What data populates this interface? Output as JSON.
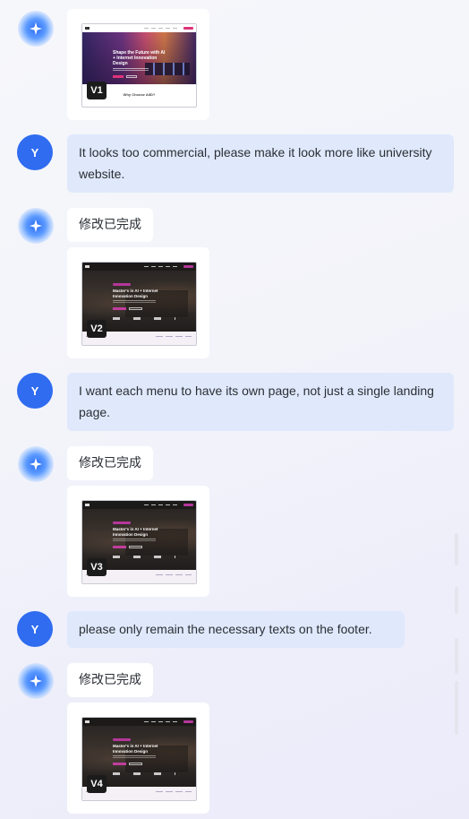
{
  "colors": {
    "user_avatar": "#2f6cf0",
    "user_bubble": "#dfe9fb",
    "ai_bubble": "#ffffff",
    "accent": "#e0337a"
  },
  "icons": {
    "ai_avatar": "sparkle-icon"
  },
  "messages": [
    {
      "role": "assistant",
      "type": "preview",
      "version": "V1",
      "thumbnail": {
        "hero_title": "Shape the Future with AI + Internet Innovation Design",
        "section_title": "Why Choose AIID?"
      }
    },
    {
      "role": "user",
      "avatar": "Y",
      "text": "It looks too commercial, please make it look more like university website."
    },
    {
      "role": "assistant",
      "text": "修改已完成",
      "version": "V2",
      "thumbnail": {
        "hero_title": "Master's in AI + Internet Innovation Design"
      }
    },
    {
      "role": "user",
      "avatar": "Y",
      "text": "I want each menu to have its own page, not just a single landing page."
    },
    {
      "role": "assistant",
      "text": "修改已完成",
      "version": "V3",
      "thumbnail": {
        "hero_title": "Master's in AI + Internet Innovation Design"
      }
    },
    {
      "role": "user",
      "avatar": "Y",
      "text": "please only remain the necessary texts on the footer."
    },
    {
      "role": "assistant",
      "text": "修改已完成",
      "version": "V4",
      "thumbnail": {
        "hero_title": "Master's in AI + Internet Innovation Design"
      }
    }
  ]
}
